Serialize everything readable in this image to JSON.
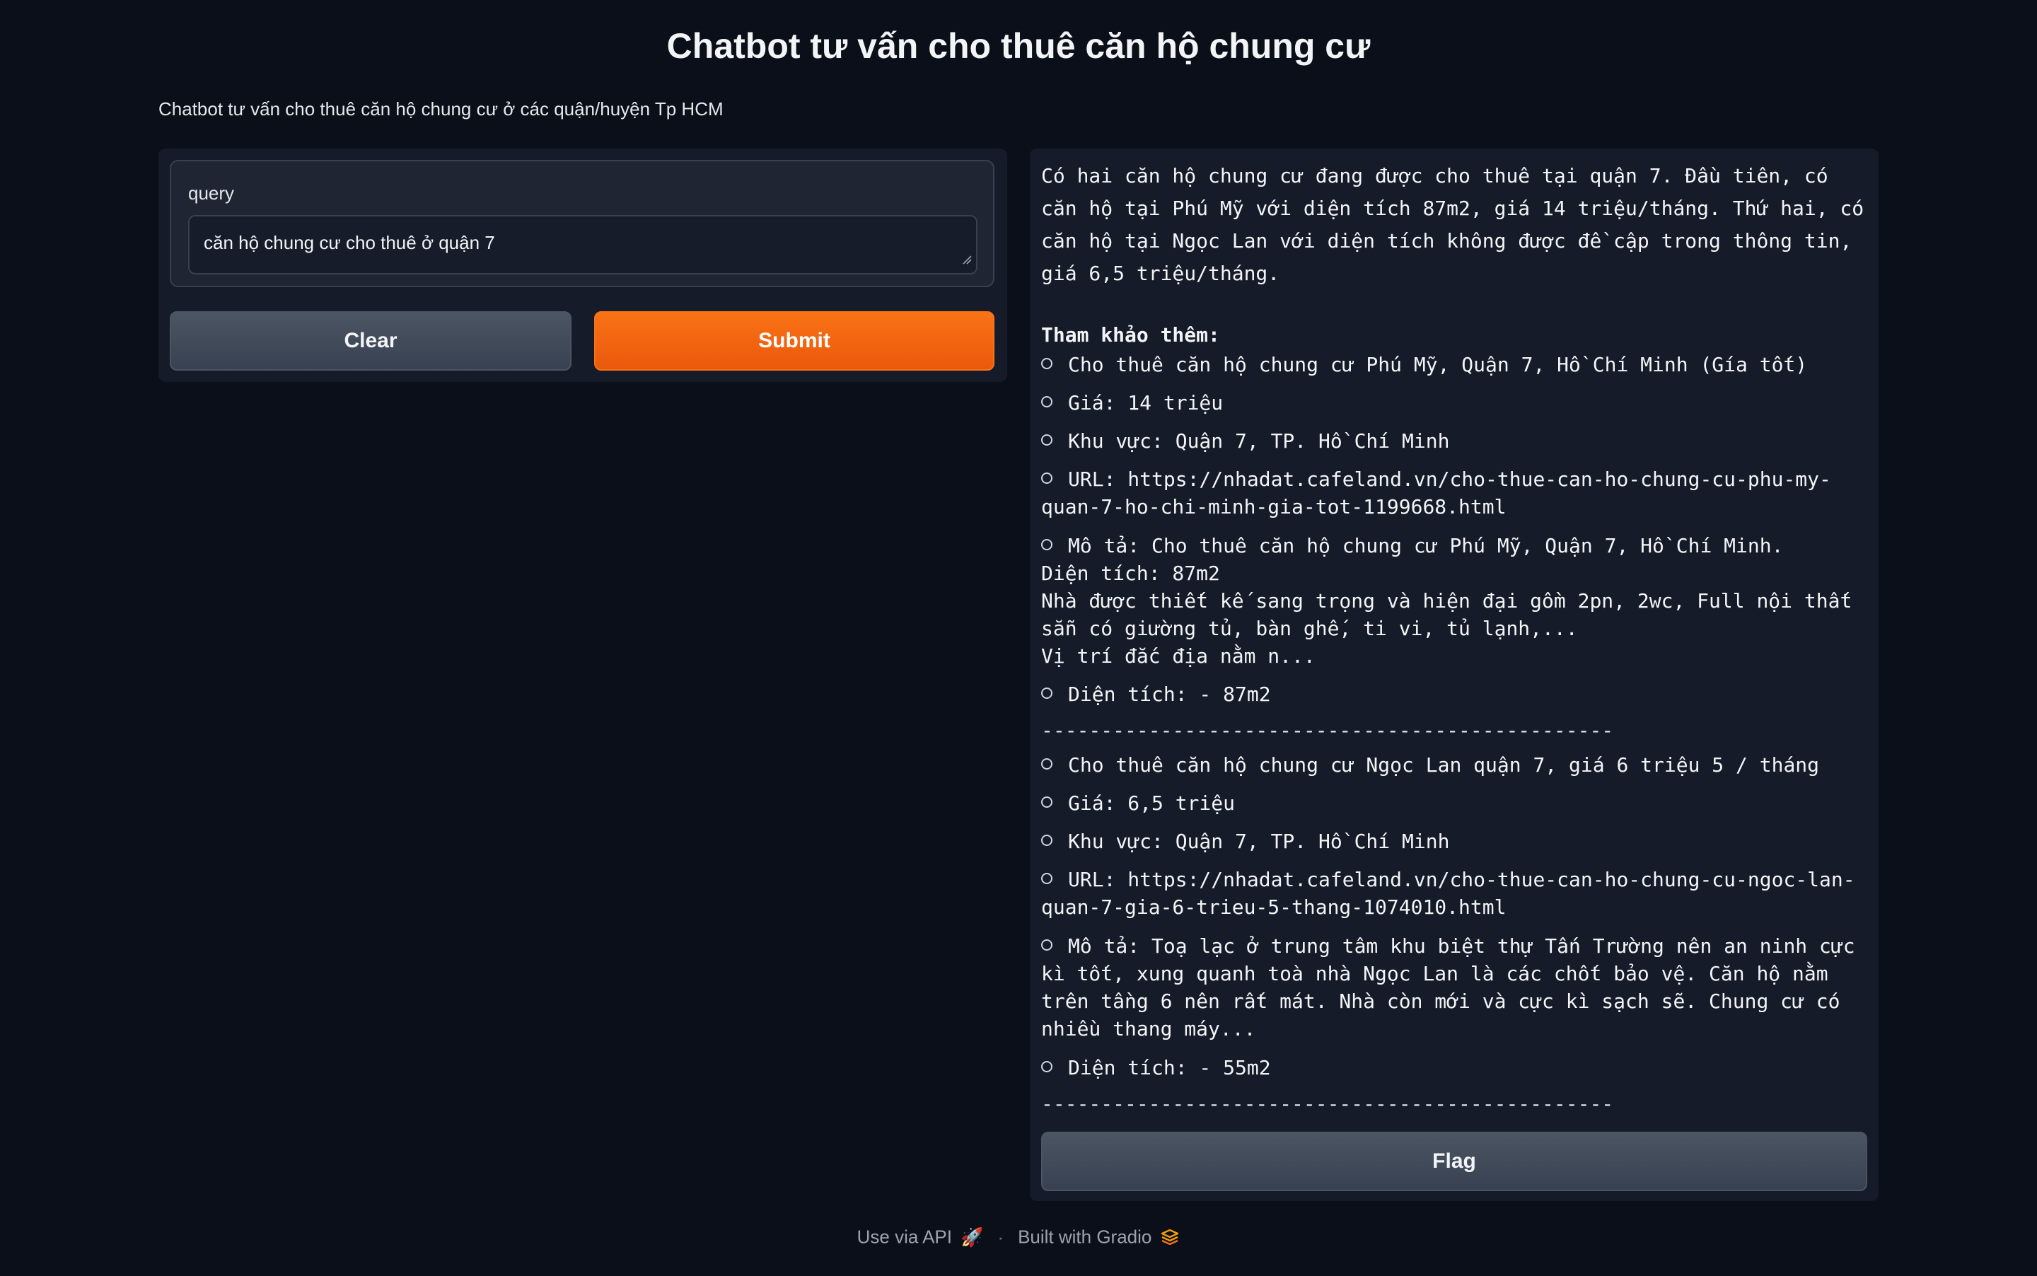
{
  "header": {
    "title": "Chatbot tư vấn cho thuê căn hộ chung cư",
    "description": "Chatbot tư vấn cho thuê căn hộ chung cư ở các quận/huyện Tp HCM"
  },
  "input": {
    "label": "query",
    "value": "căn hộ chung cư cho thuê ở quận 7"
  },
  "buttons": {
    "clear": "Clear",
    "submit": "Submit",
    "flag": "Flag"
  },
  "output": {
    "summary": "Có hai căn hộ chung cư đang được cho thuê tại quận 7. Đầu tiên, có căn hộ tại Phú Mỹ với diện tích 87m2, giá 14 triệu/tháng. Thứ hai, có căn hộ tại Ngọc Lan với diện tích không được đề cập trong thông tin, giá 6,5 triệu/tháng.",
    "refs_title": "Tham khảo thêm:",
    "listings": [
      {
        "title": "Cho thuê căn hộ chung cư Phú Mỹ, Quận 7, Hồ Chí Minh (Gía tốt)",
        "price": "Giá: 14 triệu",
        "area_loc": "Khu vực: Quận 7, TP. Hồ Chí Minh",
        "url_1": "URL: https://nhadat.cafeland.vn/cho-thue-can-ho-chung-cu-phu-my-",
        "url_2": "quan-7-ho-chi-minh-gia-tot-1199668.html",
        "desc_1": "Mô tả: Cho thuê căn hộ chung cư Phú Mỹ, Quận 7, Hồ Chí Minh.",
        "desc_2": "Diện tích: 87m2",
        "desc_3": "Nhà được thiết kế sang trọng và hiện đại gồm 2pn, 2wc, Full nội thất",
        "desc_4": "sẵn có giường tủ, bàn ghế, ti vi, tủ lạnh,...",
        "desc_5": "Vị trí đắc địa nằm n...",
        "size": "Diện tích: - 87m2"
      },
      {
        "title": "Cho thuê căn hộ chung cư Ngọc Lan quận 7, giá 6 triệu 5 / tháng",
        "price": "Giá: 6,5 triệu",
        "area_loc": "Khu vực: Quận 7, TP. Hồ Chí Minh",
        "url_1": "URL: https://nhadat.cafeland.vn/cho-thue-can-ho-chung-cu-ngoc-lan-",
        "url_2": "quan-7-gia-6-trieu-5-thang-1074010.html",
        "desc_1": "Mô tả: Toạ lạc ở trung tâm khu biệt thự Tấn Trường nên an ninh cực",
        "desc_2": "kì tốt, xung quanh toà nhà Ngọc Lan là các chốt bảo vệ. Căn hộ nằm",
        "desc_3": "trên tầng 6 nên rất mát. Nhà còn mới và cực kì sạch sẽ. Chung cư có",
        "desc_4": "nhiều thang máy...",
        "size": "Diện tích: - 55m2"
      }
    ],
    "divider": "------------------------------------------------"
  },
  "footer": {
    "api": "Use via API",
    "separator": "·",
    "built": "Built with Gradio"
  }
}
